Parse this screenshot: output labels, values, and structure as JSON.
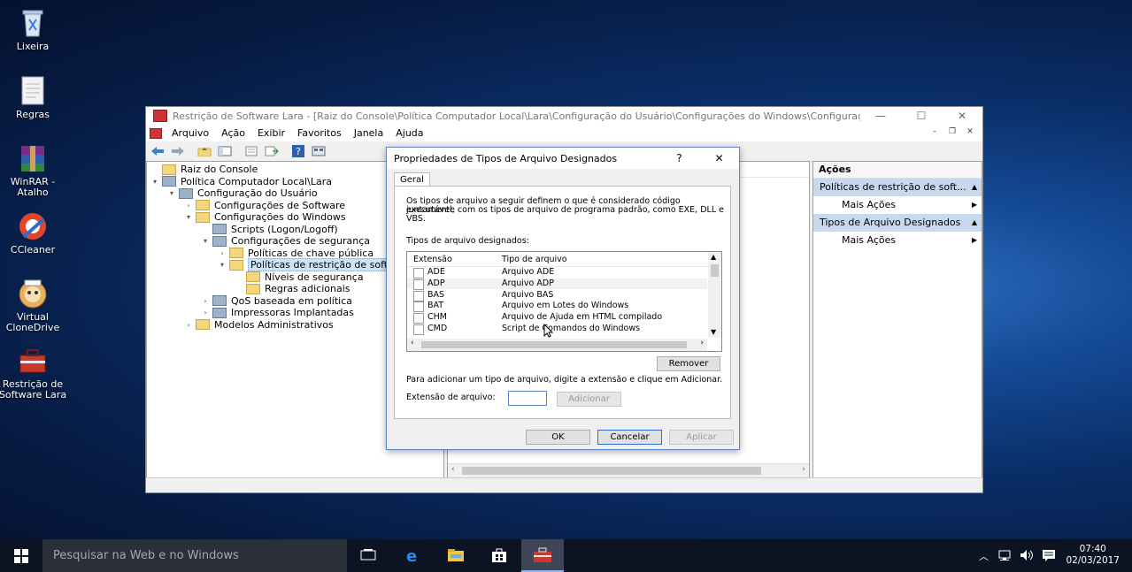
{
  "desktop": {
    "icons": [
      {
        "label": "Lixeira",
        "icon": "recycle-bin-icon"
      },
      {
        "label": "Regras",
        "icon": "text-file-icon"
      },
      {
        "label": "WinRAR - Atalho",
        "icon": "winrar-icon"
      },
      {
        "label": "CCleaner",
        "icon": "ccleaner-icon"
      },
      {
        "label": "Virtual CloneDrive",
        "icon": "virtual-clonedrive-icon"
      },
      {
        "label": "Restrição de Software Lara",
        "icon": "toolbox-icon"
      }
    ]
  },
  "window": {
    "title": "Restrição de Software Lara - [Raiz do Console\\Política Computador Local\\Lara\\Configuração do Usuário\\Configurações do Windows\\Configuraç...",
    "controls": {
      "minimize": "—",
      "maximize": "☐",
      "close": "✕"
    },
    "menu": [
      "Arquivo",
      "Ação",
      "Exibir",
      "Favoritos",
      "Janela",
      "Ajuda"
    ],
    "mdi_controls": {
      "minimize": "–",
      "restore": "❐",
      "close": "✕"
    }
  },
  "tree": {
    "items": [
      {
        "label": "Raiz do Console",
        "level": 0,
        "expander": "",
        "icon": "folder"
      },
      {
        "label": "Política Computador Local\\Lara",
        "level": 0,
        "expander": "▾",
        "icon": "gear"
      },
      {
        "label": "Configuração do Usuário",
        "level": 1,
        "expander": "▾",
        "icon": "gear"
      },
      {
        "label": "Configurações de Software",
        "level": 2,
        "expander": "›",
        "icon": "folder"
      },
      {
        "label": "Configurações do Windows",
        "level": 2,
        "expander": "▾",
        "icon": "folder"
      },
      {
        "label": "Scripts (Logon/Logoff)",
        "level": 3,
        "expander": "",
        "icon": "gear"
      },
      {
        "label": "Configurações de segurança",
        "level": 3,
        "expander": "▾",
        "icon": "gear"
      },
      {
        "label": "Políticas de chave pública",
        "level": 4,
        "expander": "›",
        "icon": "folder"
      },
      {
        "label": "Políticas de restrição de softv",
        "level": 4,
        "expander": "▾",
        "icon": "folder",
        "selected": true
      },
      {
        "label": "Níveis de segurança",
        "level": 5,
        "expander": "",
        "icon": "folder"
      },
      {
        "label": "Regras adicionais",
        "level": 5,
        "expander": "",
        "icon": "folder"
      },
      {
        "label": "QoS baseada em política",
        "level": 3,
        "expander": "›",
        "icon": "gear"
      },
      {
        "label": "Impressoras Implantadas",
        "level": 3,
        "expander": "›",
        "icon": "gear"
      },
      {
        "label": "Modelos Administrativos",
        "level": 2,
        "expander": "›",
        "icon": "folder"
      }
    ]
  },
  "actions": {
    "header": "Ações",
    "sections": [
      {
        "title": "Políticas de restrição de soft...",
        "item": "Mais Ações"
      },
      {
        "title": "Tipos de Arquivo Designados",
        "item": "Mais Ações"
      }
    ]
  },
  "dialog": {
    "title": "Propriedades de Tipos de Arquivo Designados",
    "help": "?",
    "close": "✕",
    "tab": "Geral",
    "description_line1": "Os tipos de arquivo a seguir definem o que é considerado código executável,",
    "description_line2": "juntamente com os tipos de arquivo de programa padrão, como EXE, DLL e",
    "description_line3": "VBS.",
    "list_label": "Tipos de arquivo designados:",
    "columns": {
      "ext": "Extensão",
      "type": "Tipo de arquivo"
    },
    "rows": [
      {
        "ext": "ADE",
        "type": "Arquivo ADE"
      },
      {
        "ext": "ADP",
        "type": "Arquivo ADP"
      },
      {
        "ext": "BAS",
        "type": "Arquivo BAS"
      },
      {
        "ext": "BAT",
        "type": "Arquivo em Lotes do Windows"
      },
      {
        "ext": "CHM",
        "type": "Arquivo de Ajuda em HTML compilado"
      },
      {
        "ext": "CMD",
        "type": "Script de Comandos do Windows"
      }
    ],
    "remove_button": "Remover",
    "add_hint": "Para adicionar um tipo de arquivo, digite a extensão e clique em Adicionar.",
    "ext_label": "Extensão de arquivo:",
    "ext_value": "",
    "add_button": "Adicionar",
    "ok_button": "OK",
    "cancel_button": "Cancelar",
    "apply_button": "Aplicar"
  },
  "taskbar": {
    "search_placeholder": "Pesquisar na Web e no Windows",
    "time": "07:40",
    "date": "02/03/2017"
  }
}
